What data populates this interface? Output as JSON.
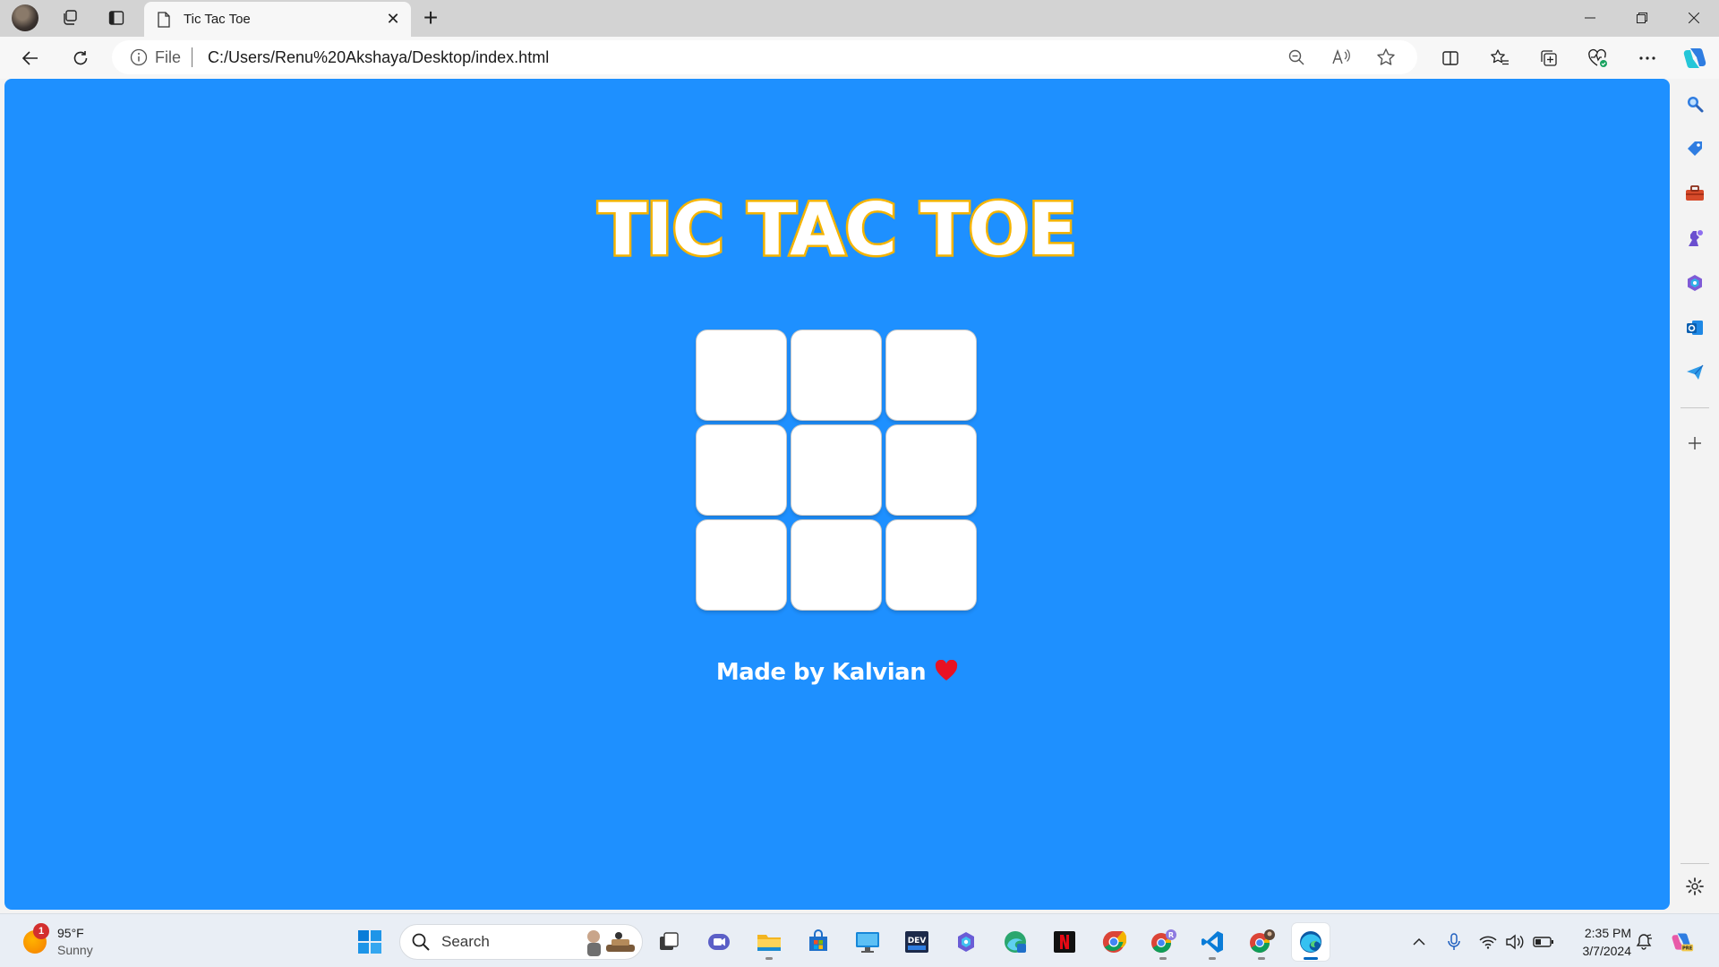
{
  "browser": {
    "tab_title": "Tic Tac Toe",
    "address_scheme_label": "File",
    "address_url": "C:/Users/Renu%20Akshaya/Desktop/index.html"
  },
  "page": {
    "title": "TIC TAC TOE",
    "board_cells": [
      "",
      "",
      "",
      "",
      "",
      "",
      "",
      "",
      ""
    ],
    "footer_text": "Made by Kalvian",
    "colors": {
      "background": "#1e90ff",
      "title_outline": "#f5b400",
      "cell": "#ffffff",
      "heart": "#e81123"
    }
  },
  "taskbar": {
    "weather": {
      "temperature": "95°F",
      "condition": "Sunny",
      "alert_count": "1"
    },
    "search_label": "Search",
    "clock": {
      "time": "2:35 PM",
      "date": "3/7/2024"
    }
  }
}
